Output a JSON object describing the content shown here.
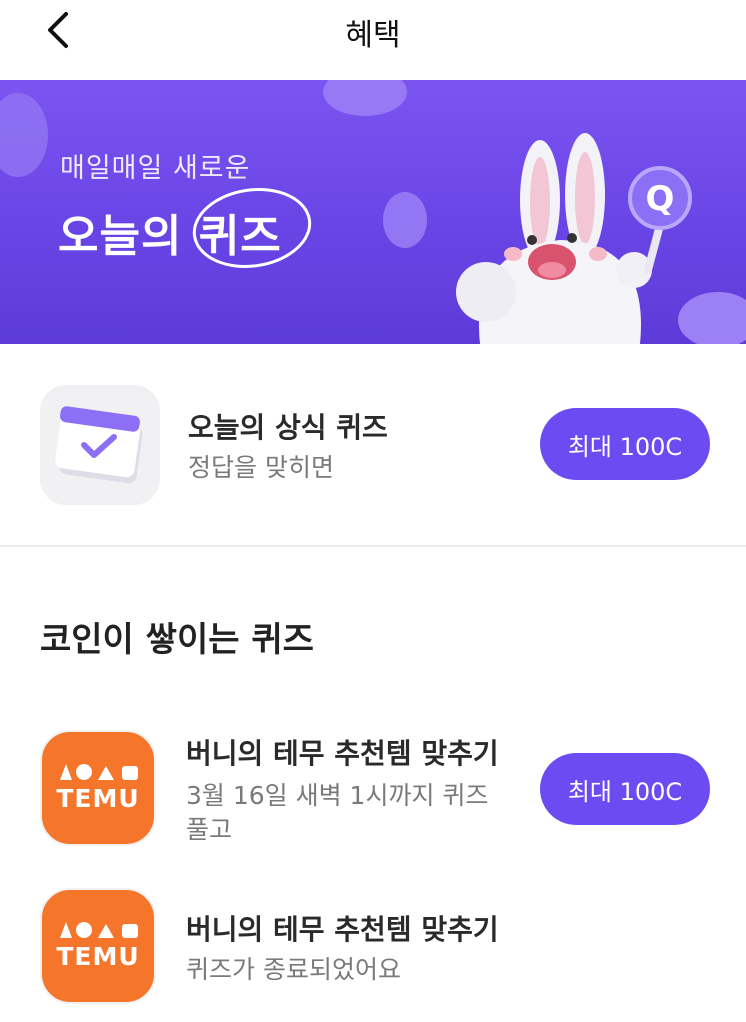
{
  "header": {
    "title": "혜택"
  },
  "banner": {
    "subtitle": "매일매일 새로운",
    "title": "오늘의 퀴즈"
  },
  "daily_quiz": {
    "title": "오늘의 상식 퀴즈",
    "subtitle": "정답을 맞히면",
    "button_label": "최대 100C"
  },
  "coin_section": {
    "title": "코인이 쌓이는 퀴즈",
    "items": [
      {
        "logo_text": "TEMU",
        "title": "버니의 테무 추천템 맞추기",
        "subtitle_line1": "3월 16일 새벽 1시까지 퀴즈",
        "subtitle_line2": "풀고",
        "button_label": "최대 100C"
      },
      {
        "logo_text": "TEMU",
        "title": "버니의 테무 추천템 맞추기",
        "subtitle_line1": "퀴즈가 종료되었어요"
      }
    ]
  },
  "colors": {
    "accent": "#6c4cf2",
    "banner": "#7b55f0",
    "temu": "#f5762a"
  }
}
